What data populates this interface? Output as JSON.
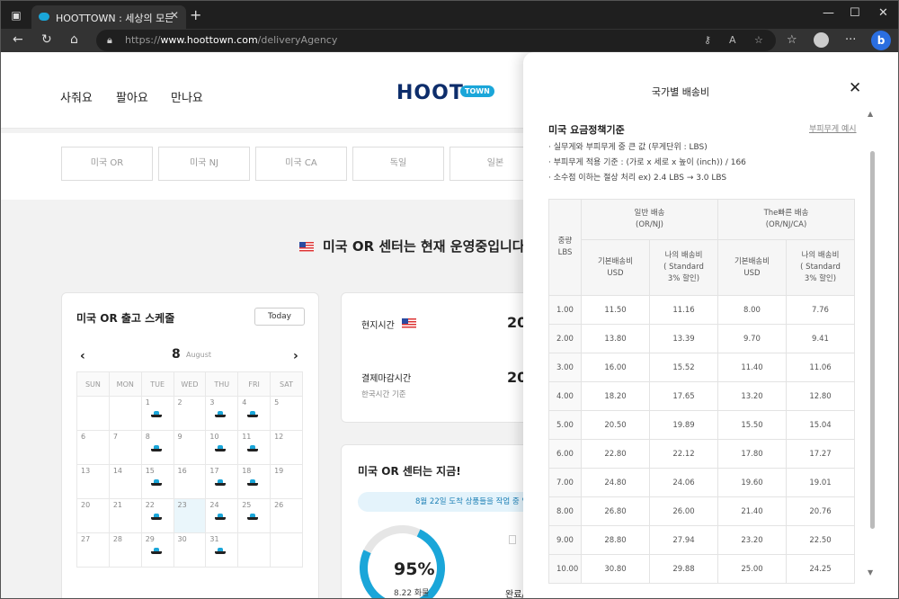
{
  "browser": {
    "tab_title": "HOOTTOWN : 세상의 모든 상품",
    "url_prefix": "https://",
    "url_host": "www.hoottown.com",
    "url_path": "/deliveryAgency",
    "icons": [
      "tab-actions-icon",
      "site-favicon",
      "close-icon",
      "plus-icon",
      "minimize-icon",
      "maximize-icon",
      "back-icon",
      "refresh-icon",
      "home-icon",
      "lock-icon",
      "key-icon",
      "read-aloud-icon",
      "favorite-star-icon",
      "collections-icon",
      "profile-avatar",
      "more-icon",
      "bing-icon"
    ]
  },
  "header": {
    "menu": [
      "사줘요",
      "팔아요",
      "만나요"
    ],
    "logo": "HOOT",
    "logo_badge": "TOWN"
  },
  "center_tabs": [
    "미국 OR",
    "미국 NJ",
    "미국 CA",
    "독일",
    "일본"
  ],
  "headline": "미국 OR 센터는 현재 운영중입니다",
  "schedule": {
    "title": "미국 OR 출고 스케줄",
    "today_label": "Today",
    "month_num": "8",
    "month_name": "August",
    "weekdays": [
      "SUN",
      "MON",
      "TUE",
      "WED",
      "THU",
      "FRI",
      "SAT"
    ],
    "weeks": [
      [
        "",
        "",
        "1",
        "2",
        "3",
        "4",
        "5"
      ],
      [
        "6",
        "7",
        "8",
        "9",
        "10",
        "11",
        "12"
      ],
      [
        "13",
        "14",
        "15",
        "16",
        "17",
        "18",
        "19"
      ],
      [
        "20",
        "21",
        "22",
        "23",
        "24",
        "25",
        "26"
      ],
      [
        "27",
        "28",
        "29",
        "30",
        "31",
        "",
        ""
      ]
    ],
    "ship_days": [
      "1",
      "3",
      "4",
      "8",
      "10",
      "11",
      "15",
      "17",
      "18",
      "22",
      "24",
      "25",
      "29",
      "31"
    ],
    "highlight_day": "23"
  },
  "times": {
    "local_label": "현지시간",
    "local_value": "20",
    "deadline_label": "결제마감시간",
    "deadline_sub": "한국시간 기준",
    "deadline_value": "20"
  },
  "status": {
    "title": "미국 OR 센터는 지금!",
    "pill": "8월 22일 도착 상품들을 작업 중 입",
    "percent": "95%",
    "sub": "8.22 화물",
    "done": "완료/"
  },
  "panel": {
    "title": "국가별 배송비",
    "policy_title": "미국 요금정책기준",
    "policy_link": "부피무게 예시",
    "bullets": [
      "· 실무게와 부피무게 중 큰 값 (무게단위 : LBS)",
      "· 부피무게 적용 기준 : (가로 x 세로 x 높이 (inch)) / 166",
      "· 소수점 이하는 절상 처리 ex) 2.4 LBS → 3.0 LBS"
    ],
    "table": {
      "weight_header": "중량\nLBS",
      "group1": "일반 배송\n(OR/NJ)",
      "group2": "The빠른 배송\n(OR/NJ/CA)",
      "sub_base": "기본배송비\nUSD",
      "sub_mine": "나의 배송비\n( Standard\n3% 할인)",
      "rows": [
        [
          "1.00",
          "11.50",
          "11.16",
          "8.00",
          "7.76"
        ],
        [
          "2.00",
          "13.80",
          "13.39",
          "9.70",
          "9.41"
        ],
        [
          "3.00",
          "16.00",
          "15.52",
          "11.40",
          "11.06"
        ],
        [
          "4.00",
          "18.20",
          "17.65",
          "13.20",
          "12.80"
        ],
        [
          "5.00",
          "20.50",
          "19.89",
          "15.50",
          "15.04"
        ],
        [
          "6.00",
          "22.80",
          "22.12",
          "17.80",
          "17.27"
        ],
        [
          "7.00",
          "24.80",
          "24.06",
          "19.60",
          "19.01"
        ],
        [
          "8.00",
          "26.80",
          "26.00",
          "21.40",
          "20.76"
        ],
        [
          "9.00",
          "28.80",
          "27.94",
          "23.20",
          "22.50"
        ],
        [
          "10.00",
          "30.80",
          "29.88",
          "25.00",
          "24.25"
        ]
      ]
    }
  }
}
